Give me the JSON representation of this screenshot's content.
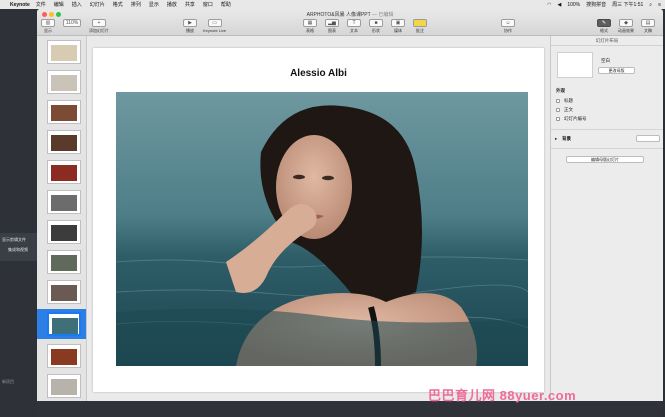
{
  "menubar": {
    "app": "Keynote",
    "items": [
      "文件",
      "编辑",
      "插入",
      "幻灯片",
      "格式",
      "排列",
      "显示",
      "播放",
      "共享",
      "窗口",
      "帮助"
    ],
    "status": {
      "battery": "100%",
      "input": "搜狗拼音",
      "clock": "周三 下午1:51"
    }
  },
  "window": {
    "title": "ARPHOTO&风暴 人像课PPT",
    "status_tag": "— 已编辑",
    "toolbar": {
      "view": "显示",
      "zoom": "110%",
      "add_slide": "添加幻灯片",
      "play": "播放",
      "keynote_live": "Keynote Live",
      "table": "表格",
      "chart": "图表",
      "text": "文本",
      "shape": "形状",
      "media": "媒体",
      "comment": "批注",
      "collaborate": "协作",
      "format": "格式",
      "animate": "动画效果",
      "document": "文稿"
    }
  },
  "desktop": {
    "line1": "显示剪辑文件",
    "line2": "集成和视频",
    "line3": "新项目"
  },
  "navigator": {
    "slide_numbers": [
      "",
      "",
      "",
      "",
      "",
      "",
      "",
      "",
      "",
      "",
      "",
      "",
      "",
      "",
      "",
      "",
      "",
      ""
    ]
  },
  "slide": {
    "title": "Alessio Albi"
  },
  "inspector": {
    "header": "幻灯片布局",
    "layout_name": "空白",
    "change_master": "更改母版",
    "appearance": "外观",
    "opt_title": "标题",
    "opt_body": "正文",
    "opt_slide_number": "幻灯片编号",
    "background": "背景",
    "edit_master": "编辑母版幻灯片"
  },
  "watermark": "巴巴育儿网 88yuer.com",
  "colors": {
    "accent": "#2d7fe5",
    "watermark": "#f06a9a"
  }
}
